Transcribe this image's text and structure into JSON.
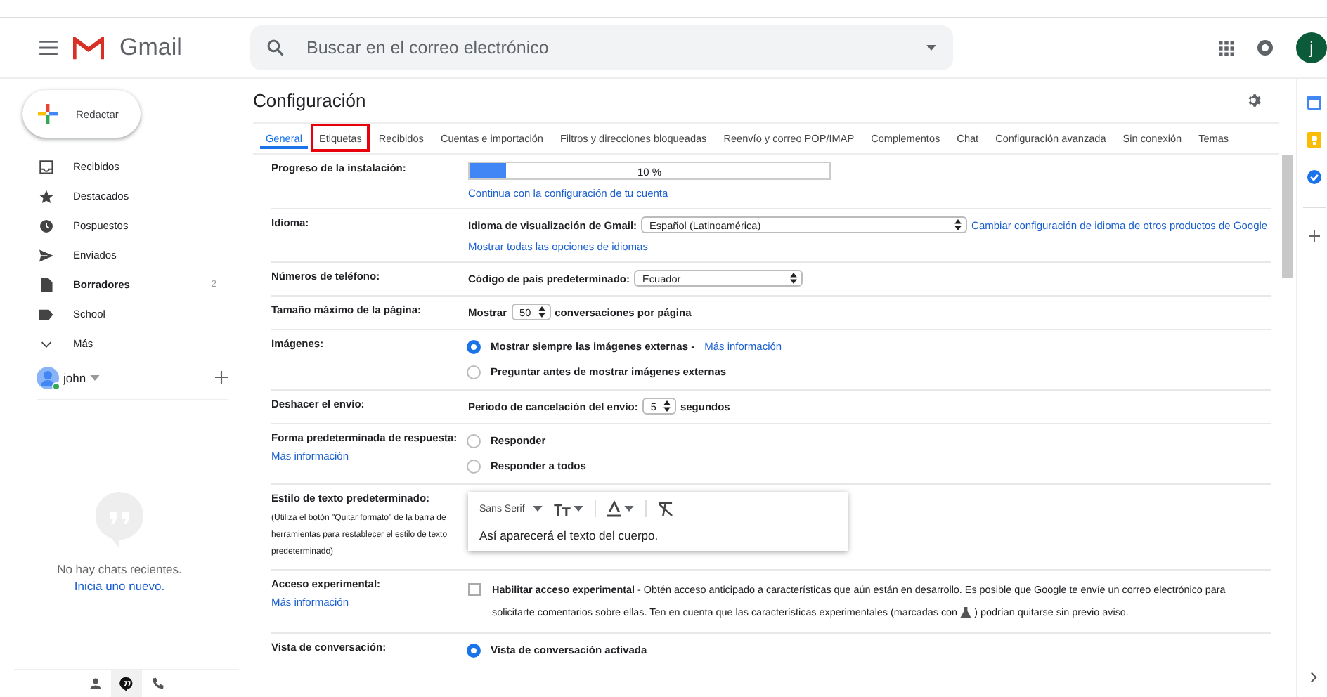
{
  "header": {
    "app_name": "Gmail",
    "search": {
      "placeholder": "Buscar en el correo electrónico"
    },
    "account_initial": "j"
  },
  "sidebar": {
    "compose": "Redactar",
    "items": [
      {
        "label": "Recibidos",
        "unread": false
      },
      {
        "label": "Destacados",
        "unread": false
      },
      {
        "label": "Pospuestos",
        "unread": false
      },
      {
        "label": "Enviados",
        "unread": false
      },
      {
        "label": "Borradores",
        "count": "2",
        "unread": true
      },
      {
        "label": "School",
        "unread": false
      },
      {
        "label": "Más",
        "unread": false
      }
    ],
    "chat_user": {
      "name": "john",
      "online": true
    },
    "chat_empty": "No hay chats recientes.",
    "chat_start": "Inicia uno nuevo.",
    "chat_tabs": [
      {
        "selected": false
      },
      {
        "selected": true
      },
      {
        "selected": false
      }
    ]
  },
  "settings": {
    "title": "Configuración",
    "tabs": [
      {
        "label": "General",
        "selected": true,
        "annotated": false
      },
      {
        "label": "Etiquetas",
        "selected": false,
        "annotated": true
      },
      {
        "label": "Recibidos",
        "selected": false,
        "annotated": false
      },
      {
        "label": "Cuentas e importación",
        "selected": false,
        "annotated": false
      },
      {
        "label": "Filtros y direcciones bloqueadas",
        "selected": false,
        "annotated": false
      },
      {
        "label": "Reenvío y correo POP/IMAP",
        "selected": false,
        "annotated": false
      },
      {
        "label": "Complementos",
        "selected": false,
        "annotated": false
      },
      {
        "label": "Chat",
        "selected": false,
        "annotated": false
      },
      {
        "label": "Configuración avanzada",
        "selected": false,
        "annotated": false
      },
      {
        "label": "Sin conexión",
        "selected": false,
        "annotated": false
      },
      {
        "label": "Temas",
        "selected": false,
        "annotated": false
      }
    ],
    "rows": [
      {
        "label": "Progreso de la instalación:",
        "controls": [
          {
            "kind": "progress",
            "level": 0.1,
            "reading": "10 %"
          },
          {
            "kind": "link",
            "text": "Continua con la configuración de tu cuenta"
          }
        ]
      },
      {
        "label": "Idioma:",
        "controls": [
          {
            "kind": "select",
            "before": "Idioma de visualización de Gmail:",
            "value": "Español (Latinoamérica)",
            "link": "Cambiar configuración de idioma de otros productos de Google"
          },
          {
            "kind": "link",
            "text": "Mostrar todas las opciones de idiomas"
          }
        ]
      },
      {
        "label": "Números de teléfono:",
        "controls": [
          {
            "kind": "select",
            "before": "Código de país predeterminado:",
            "value": "Ecuador"
          }
        ]
      },
      {
        "label": "Tamaño máximo de la página:",
        "controls": [
          {
            "kind": "select",
            "before": "Mostrar",
            "value": "50",
            "after": "conversaciones por página"
          }
        ]
      },
      {
        "label": "Imágenes:",
        "controls": [
          {
            "kind": "radio",
            "text": "Mostrar siempre las imágenes externas -",
            "link": "Más información",
            "selected": true
          },
          {
            "kind": "radio",
            "text": "Preguntar antes de mostrar imágenes externas",
            "selected": false
          }
        ]
      },
      {
        "label": "Deshacer el envío:",
        "controls": [
          {
            "kind": "select",
            "before": "Período de cancelación del envío:",
            "value": "5",
            "after": "segundos"
          }
        ]
      },
      {
        "label": "Forma predeterminada de respuesta:",
        "label_link": "Más información",
        "controls": [
          {
            "kind": "radio",
            "text": "Responder",
            "selected": false
          },
          {
            "kind": "radio",
            "text": "Responder a todos",
            "selected": false
          }
        ]
      },
      {
        "label": "Estilo de texto predeterminado:",
        "note": "(Utiliza el botón \"Quitar formato\" de la barra de herramientas para restablecer el estilo de texto predeterminado)",
        "controls": [
          {
            "kind": "editor",
            "font": "Sans Serif",
            "sample": "Así aparecerá el texto del cuerpo."
          }
        ]
      },
      {
        "label": "Acceso experimental:",
        "label_link": "Más información",
        "controls": [
          {
            "kind": "checkbox",
            "checked": false,
            "text": "**Habilitar acceso experimental** - Obtén acceso anticipado a características que aún están en desarrollo. Es posible que Google te envíe un correo electrónico para",
            "text_2": "solicitarte comentarios sobre ellas. Ten en cuenta que las características experimentales (marcadas con",
            "text_end": ") podrían quitarse sin previo aviso."
          }
        ]
      },
      {
        "label": "Vista de conversación:",
        "controls": [
          {
            "kind": "radio",
            "text": "Vista de conversación activada",
            "selected": true
          }
        ]
      }
    ]
  }
}
